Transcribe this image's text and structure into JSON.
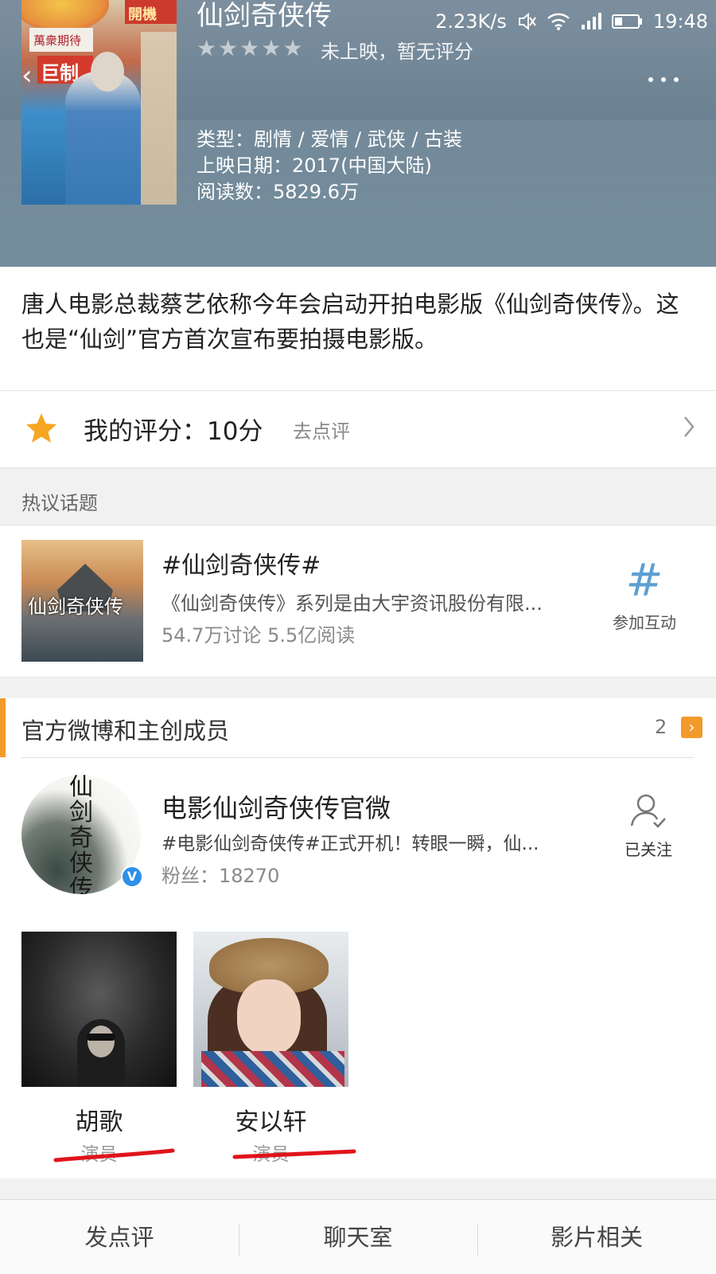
{
  "status_bar": {
    "net_speed": "2.23K/s",
    "time": "19:48"
  },
  "header": {
    "title": "仙剑奇侠传",
    "rating_text": "未上映，暂无评分",
    "genre": "类型：剧情 / 爱情 / 武侠 / 古装",
    "release": "上映日期：2017(中国大陆)",
    "reads": "阅读数：5829.6万",
    "poster": {
      "sign_top": "萬衆期待",
      "sign_big": "巨制",
      "sign_right": "開機"
    }
  },
  "description": "唐人电影总裁蔡艺依称今年会启动开拍电影版《仙剑奇侠传》。这也是“仙剑”官方首次宣布要拍摄电影版。",
  "my_rating": {
    "label": "我的评分：10分",
    "action": "去点评"
  },
  "hot_topics": {
    "caption": "热议话题",
    "topic": {
      "thumb_text": "仙剑奇侠传",
      "title": "#仙剑奇侠传#",
      "summary": "《仙剑奇侠传》系列是由大宇资讯股份有限...",
      "stats": "54.7万讨论  5.5亿阅读",
      "join_label": "参加互动"
    }
  },
  "official": {
    "title": "官方微博和主创成员",
    "count": "2",
    "account": {
      "avatar_text": "仙剑奇侠传",
      "name": "电影仙剑奇侠传官微",
      "post": "#电影仙剑奇侠传#正式开机！转眼一瞬，仙...",
      "fans": "粉丝：18270",
      "follow_label": "已关注"
    },
    "members": [
      {
        "name": "胡歌",
        "role": "演员"
      },
      {
        "name": "安以轩",
        "role": "演员"
      }
    ]
  },
  "bottom_tabs": [
    {
      "label": "发点评"
    },
    {
      "label": "聊天室"
    },
    {
      "label": "影片相关"
    }
  ],
  "colors": {
    "accent": "#f39a2b",
    "link_blue": "#5d9fd3",
    "verified_blue": "#2f8fe6",
    "annotation_red": "#e0141b"
  }
}
